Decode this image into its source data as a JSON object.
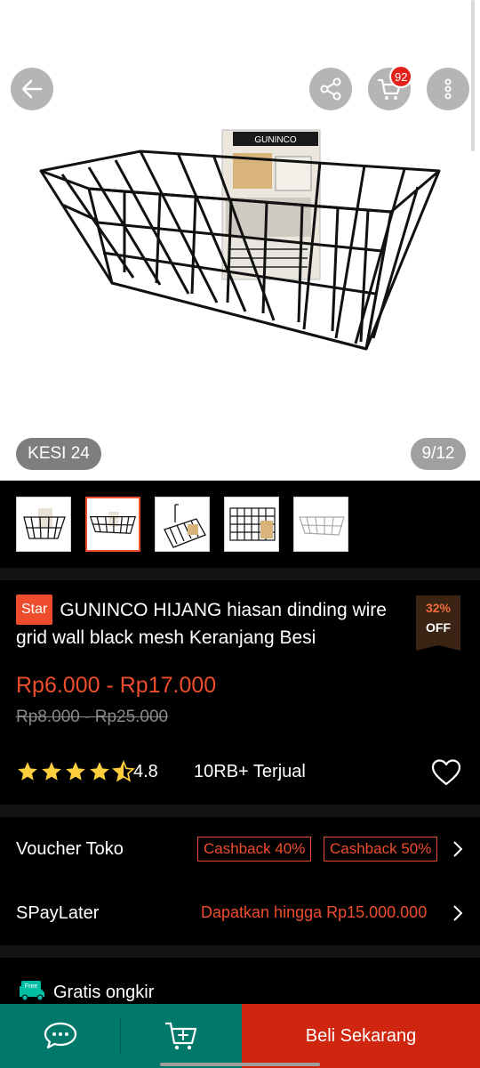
{
  "gallery": {
    "variant_label": "KESI 24",
    "counter": "9/12",
    "cart_count": "92",
    "package_brand": "GUNINCO",
    "thumbnails": [
      "basket-small",
      "basket-black",
      "shelf-basket",
      "wire-grid-panel",
      "white-basket"
    ],
    "active_thumbnail_index": 1
  },
  "product": {
    "tag": "Star",
    "title": "GUNINCO HIJANG hiasan dinding wire grid wall black mesh Keranjang Besi",
    "discount_pct": "32%",
    "discount_off": "OFF",
    "price_range": "Rp6.000 - Rp17.000",
    "original_price_range": "Rp8.000 - Rp25.000",
    "rating": "4.8",
    "rating_stars": 4.5,
    "sold": "10RB+ Terjual"
  },
  "voucher": {
    "label": "Voucher Toko",
    "items": [
      "Cashback 40%",
      "Cashback 50%"
    ]
  },
  "spaylater": {
    "label": "SPayLater",
    "text": "Dapatkan hingga Rp15.000.000"
  },
  "shipping": {
    "free_badge": "Free",
    "label": "Gratis ongkir"
  },
  "actions": {
    "buy_label": "Beli Sekarang"
  },
  "colors": {
    "accent": "#ee4d2d",
    "chat_bar": "#00796b",
    "buy_bar": "#d0250f"
  }
}
